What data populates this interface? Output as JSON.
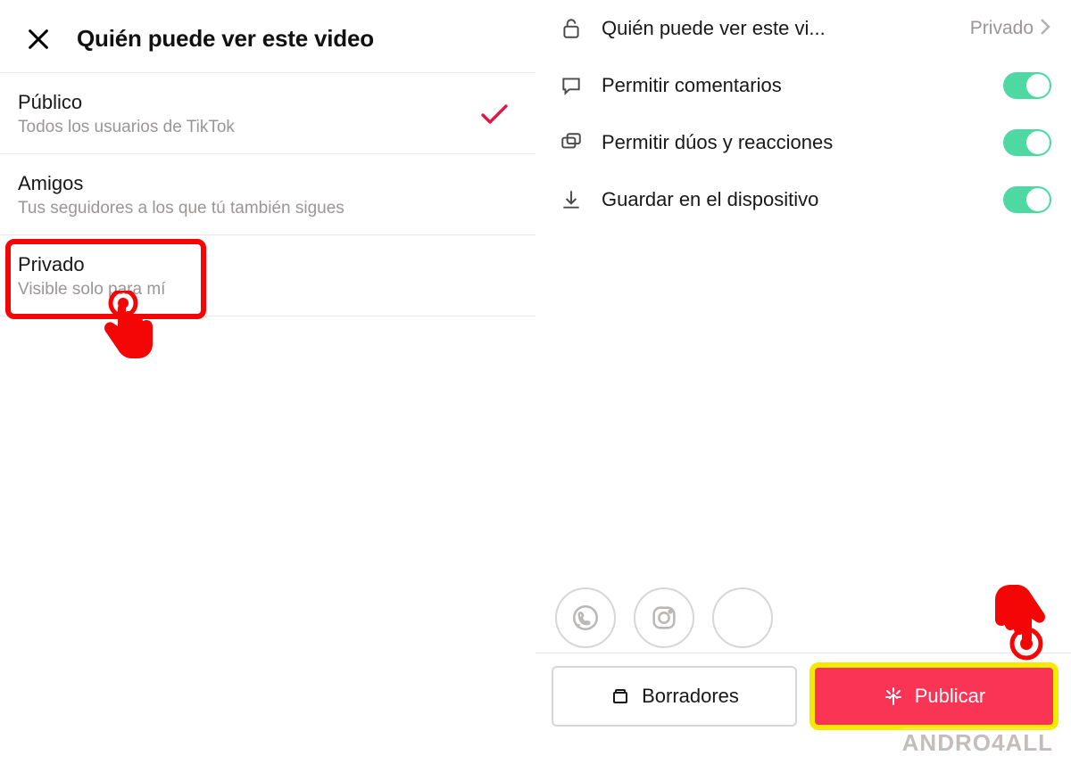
{
  "left": {
    "title": "Quién puede ver este video",
    "options": [
      {
        "title": "Público",
        "sub": "Todos los usuarios de TikTok",
        "checked": true
      },
      {
        "title": "Amigos",
        "sub": "Tus seguidores a los que tú también sigues",
        "checked": false
      },
      {
        "title": "Privado",
        "sub": "Visible solo para mí",
        "checked": false
      }
    ]
  },
  "right": {
    "privacy_row": {
      "label": "Quién puede ver este vi...",
      "value": "Privado"
    },
    "comments_row": {
      "label": "Permitir comentarios"
    },
    "duets_row": {
      "label": "Permitir dúos y reacciones"
    },
    "save_row": {
      "label": "Guardar en el dispositivo"
    },
    "drafts_label": "Borradores",
    "publish_label": "Publicar"
  },
  "watermark": "ANDRO4ALL"
}
